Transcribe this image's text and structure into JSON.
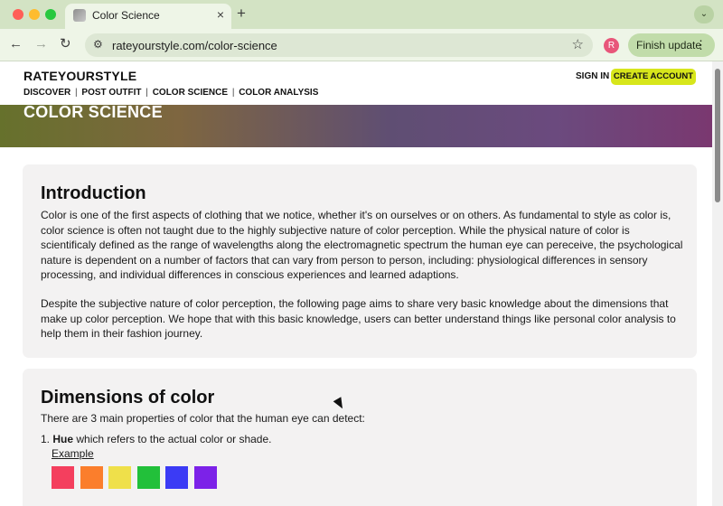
{
  "browser": {
    "tab_title": "Color Science",
    "tab_close": "×",
    "new_tab": "+",
    "tab_menu": "⌄",
    "back": "←",
    "forward": "→",
    "reload": "↻",
    "site_info": "⚙",
    "url": "rateyourstyle.com/color-science",
    "star": "☆",
    "profile_initial": "R",
    "finish_update": "Finish update",
    "menu_kebab": "⋮"
  },
  "site": {
    "brand": "RATEYOURSTYLE",
    "nav": [
      "DISCOVER",
      "POST OUTFIT",
      "COLOR SCIENCE",
      "COLOR ANALYSIS"
    ],
    "nav_separator": "|",
    "sign_in": "SIGN IN",
    "create_account": "CREATE ACCOUNT",
    "hero_title": "COLOR SCIENCE"
  },
  "intro": {
    "heading": "Introduction",
    "paragraph_1": "Color is one of the first aspects of clothing that we notice, whether it's on ourselves or on others. As fundamental to style as color is, color science is often not taught due to the highly subjective nature of color perception. While the physical nature of color is scientificaly defined as the range of wavelengths along the electromagnetic spectrum the human eye can pereceive, the psychological nature is dependent on a number of factors that can vary from person to person, including: physiological differences in sensory processing, and individual differences in conscious experiences and learned adaptions.",
    "paragraph_2": "Despite the subjective nature of color perception, the following page aims to share very basic knowledge about the dimensions that make up color perception. We hope that with this basic knowledge, users can better understand things like personal color analysis to help them in their fashion journey."
  },
  "dimensions": {
    "heading": "Dimensions of color",
    "lead": "There are 3 main properties of color that the human eye can detect:",
    "item_number": "1.",
    "item_term": "Hue",
    "item_text": "which refers to the actual color or shade.",
    "example_label": "Example",
    "swatches": [
      "#f43f5e",
      "#fb7e2c",
      "#efe04a",
      "#22c03a",
      "#3b3bf5",
      "#7c22e8"
    ]
  }
}
